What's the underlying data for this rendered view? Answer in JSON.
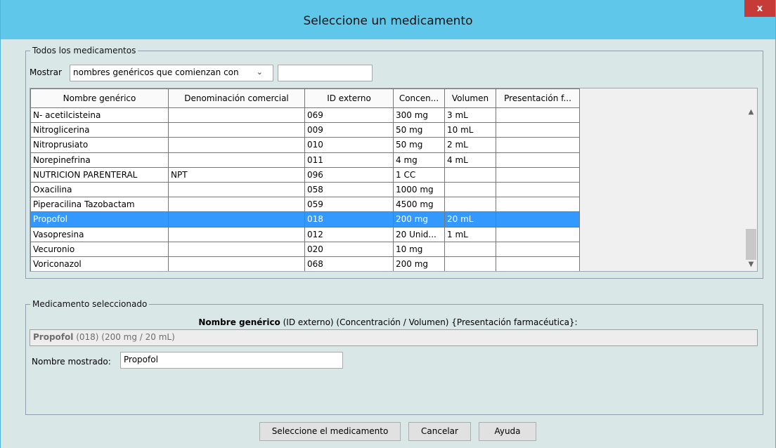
{
  "window": {
    "title": "Seleccione un medicamento",
    "close_label": "x"
  },
  "all_meds": {
    "legend": "Todos los medicamentos",
    "show_label": "Mostrar",
    "filter_mode": "nombres genéricos que comienzan con",
    "filter_value": "",
    "columns": [
      "Nombre genérico",
      "Denominación comercial",
      "ID externo",
      "Concen...",
      "Volumen",
      "Presentación f..."
    ],
    "rows": [
      [
        "N- acetilcisteina",
        "",
        "069",
        "300 mg",
        "3 mL",
        ""
      ],
      [
        "Nitroglicerina",
        "",
        "009",
        "50 mg",
        "10 mL",
        ""
      ],
      [
        "Nitroprusiato",
        "",
        "010",
        "50 mg",
        "2 mL",
        ""
      ],
      [
        "Norepinefrina",
        "",
        "011",
        "4 mg",
        "4 mL",
        ""
      ],
      [
        "NUTRICION PARENTERAL",
        "NPT",
        "096",
        "1 CC",
        "",
        ""
      ],
      [
        "Oxacilina",
        "",
        "058",
        "1000 mg",
        "",
        ""
      ],
      [
        "Piperacilina Tazobactam",
        "",
        "059",
        "4500 mg",
        "",
        ""
      ],
      [
        "Propofol",
        "",
        "018",
        "200 mg",
        "20 mL",
        ""
      ],
      [
        "Vasopresina",
        "",
        "012",
        "20 Unid...",
        "1 mL",
        ""
      ],
      [
        "Vecuronio",
        "",
        "020",
        "10 mg",
        "",
        ""
      ],
      [
        "Voriconazol",
        "",
        "068",
        "200 mg",
        "",
        ""
      ]
    ],
    "selected_row": 7
  },
  "selected_med": {
    "legend": "Medicamento seleccionado",
    "format_bold": "Nombre genérico",
    "format_rest": " (ID externo) (Concentración / Volumen) {Presentación farmacéutica}:",
    "summary_name": "Propofol",
    "summary_rest": " (018) (200 mg / 20 mL)",
    "display_label": "Nombre mostrado:",
    "display_value": "Propofol"
  },
  "buttons": {
    "select_label": "Seleccione el medicamento",
    "cancel_label": "Cancelar",
    "help_label": "Ayuda"
  },
  "colors": {
    "title_bar": "#5fc8ea",
    "selection": "#3399ff",
    "close": "#c63b38"
  }
}
